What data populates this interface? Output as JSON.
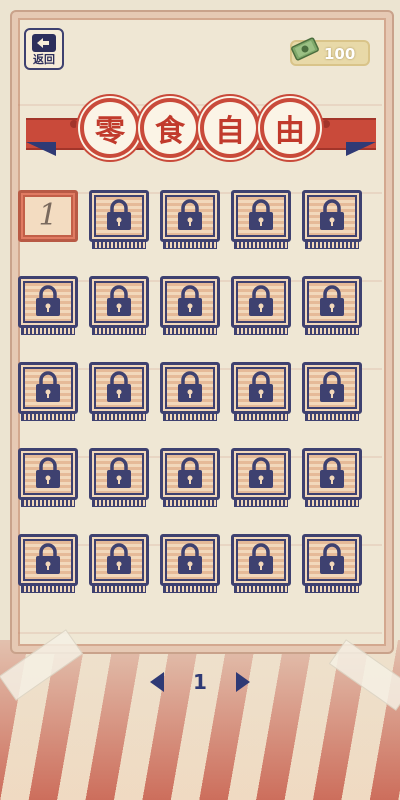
{
  "header": {
    "back_label": "返回",
    "coins": "100"
  },
  "title": {
    "chars": [
      "零",
      "食",
      "自",
      "由"
    ]
  },
  "levels": [
    {
      "number": "1",
      "locked": false
    },
    {
      "locked": true
    },
    {
      "locked": true
    },
    {
      "locked": true
    },
    {
      "locked": true
    },
    {
      "locked": true
    },
    {
      "locked": true
    },
    {
      "locked": true
    },
    {
      "locked": true
    },
    {
      "locked": true
    },
    {
      "locked": true
    },
    {
      "locked": true
    },
    {
      "locked": true
    },
    {
      "locked": true
    },
    {
      "locked": true
    },
    {
      "locked": true
    },
    {
      "locked": true
    },
    {
      "locked": true
    },
    {
      "locked": true
    },
    {
      "locked": true
    },
    {
      "locked": true
    },
    {
      "locked": true
    },
    {
      "locked": true
    },
    {
      "locked": true
    },
    {
      "locked": true
    }
  ],
  "pager": {
    "current_page": "1"
  },
  "icons": {
    "back": "back-arrow-icon",
    "money": "money-icon",
    "lock": "lock-icon",
    "prev": "triangle-left-icon",
    "next": "triangle-right-icon"
  },
  "colors": {
    "accent_red": "#c94a3a",
    "navy": "#3e4170",
    "paper": "#efe7d4"
  }
}
